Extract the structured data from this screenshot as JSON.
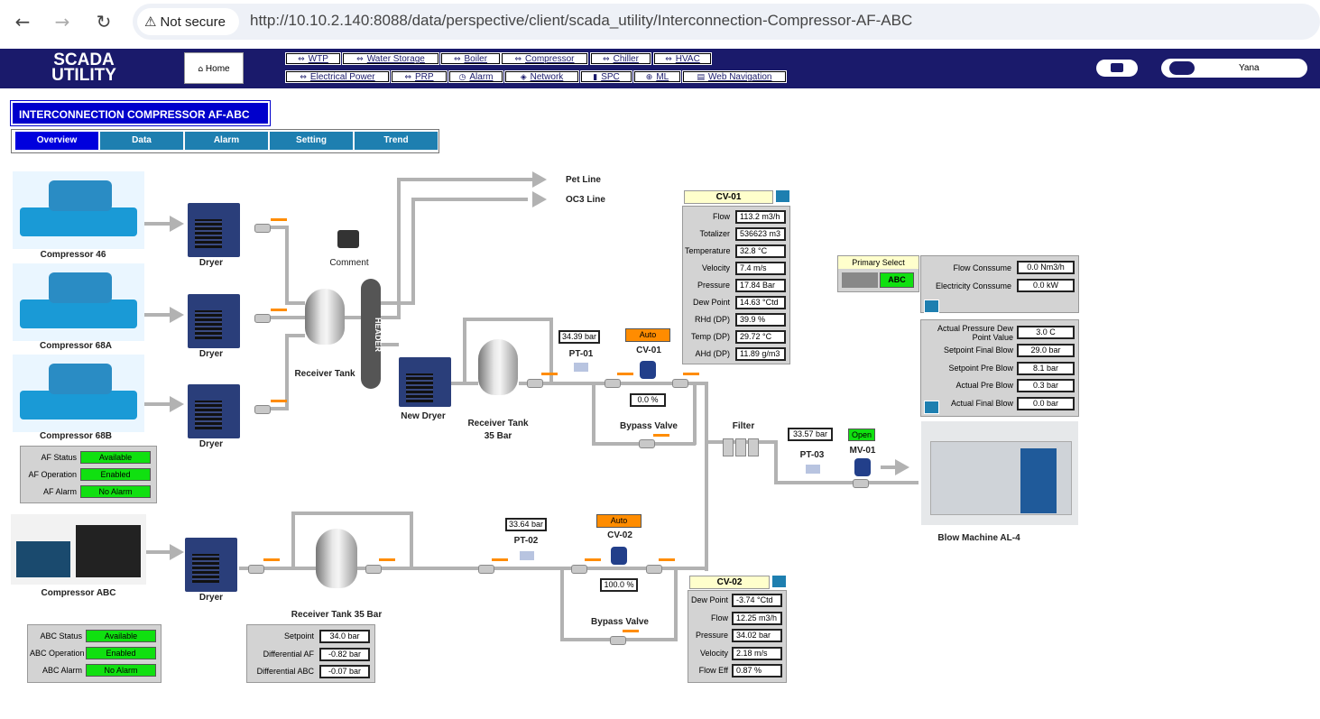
{
  "browser": {
    "security_label": "Not secure",
    "url": "http://10.10.2.140:8088/data/perspective/client/scada_utility/Interconnection-Compressor-AF-ABC"
  },
  "header": {
    "logo_line1": "SCADA",
    "logo_line2": "UTILITY",
    "home_label": "Home",
    "menu_row1": [
      "WTP",
      "Water Storage",
      "Boiler",
      "Compressor",
      "Chiller",
      "HVAC"
    ],
    "menu_row2": [
      "Electrical Power",
      "PRP",
      "Alarm",
      "Network",
      "SPC",
      "ML",
      "Web Navigation"
    ],
    "user_name": "Yana"
  },
  "page": {
    "title": "INTERCONNECTION COMPRESSOR AF-ABC",
    "tabs": [
      "Overview",
      "Data",
      "Alarm",
      "Setting",
      "Trend"
    ],
    "active_tab": "Overview"
  },
  "diagram": {
    "compressors": [
      "Compressor 46",
      "Compressor 68A",
      "Compressor 68B",
      "Compressor ABC"
    ],
    "dryer_label": "Dryer",
    "new_dryer_label": "New Dryer",
    "comment_label": "Comment",
    "receiver_tank_label": "Receiver Tank",
    "header_label": "HEADER",
    "receiver_tank_35_label": "Receiver Tank\n35 Bar",
    "receiver_tank_35b_label": "Receiver Tank 35 Bar",
    "pet_line": "Pet Line",
    "oc3_line": "OC3 Line",
    "pt01": {
      "label": "PT-01",
      "value": "34.39 bar"
    },
    "pt02": {
      "label": "PT-02",
      "value": "33.64 bar"
    },
    "pt03": {
      "label": "PT-03",
      "value": "33.57 bar"
    },
    "cv01": {
      "label": "CV-01",
      "mode": "Auto",
      "opening": "0.0 %"
    },
    "cv02": {
      "label": "CV-02",
      "mode": "Auto",
      "opening": "100.0 %"
    },
    "bypass_valve": "Bypass Valve",
    "filter": "Filter",
    "mv01": {
      "label": "MV-01",
      "state": "Open"
    },
    "blow_machine": "Blow Machine AL-4"
  },
  "af_status": [
    {
      "label": "AF Status",
      "value": "Available"
    },
    {
      "label": "AF Operation",
      "value": "Enabled"
    },
    {
      "label": "AF Alarm",
      "value": "No Alarm"
    }
  ],
  "abc_status": [
    {
      "label": "ABC Status",
      "value": "Available"
    },
    {
      "label": "ABC Operation",
      "value": "Enabled"
    },
    {
      "label": "ABC Alarm",
      "value": "No Alarm"
    }
  ],
  "setpoint_panel": [
    {
      "label": "Setpoint",
      "value": "34.0 bar"
    },
    {
      "label": "Differential AF",
      "value": "-0.82 bar"
    },
    {
      "label": "Differential ABC",
      "value": "-0.07 bar"
    }
  ],
  "cv01_panel": {
    "title": "CV-01",
    "rows": [
      {
        "label": "Flow",
        "value": "113.2 m3/h"
      },
      {
        "label": "Totalizer",
        "value": "536623 m3"
      },
      {
        "label": "Temperature",
        "value": "32.8     °C"
      },
      {
        "label": "Velocity",
        "value": "7.4       m/s"
      },
      {
        "label": "Pressure",
        "value": "17.84  Bar"
      },
      {
        "label": "Dew Point",
        "value": "14.63 °Ctd"
      },
      {
        "label": "RHd (DP)",
        "value": "39.9       %"
      },
      {
        "label": "Temp (DP)",
        "value": "29.72    °C"
      },
      {
        "label": "AHd (DP)",
        "value": "11.89 g/m3"
      }
    ]
  },
  "cv02_panel": {
    "title": "CV-02",
    "rows": [
      {
        "label": "Dew Point",
        "value": "-3.74  °Ctd"
      },
      {
        "label": "Flow",
        "value": "12.25 m3/h"
      },
      {
        "label": "Pressure",
        "value": "34.02  bar"
      },
      {
        "label": "Velocity",
        "value": "2.18    m/s"
      },
      {
        "label": "Flow Eff",
        "value": "0.87       %"
      }
    ]
  },
  "primary_select": {
    "title": "Primary Select",
    "value": "ABC"
  },
  "consume_panel": [
    {
      "label": "Flow Conssume",
      "value": "0.0 Nm3/h"
    },
    {
      "label": "Electricity Conssume",
      "value": "0.0 kW"
    }
  ],
  "blow_panel": [
    {
      "label": "Actual Pressure Dew Point Value",
      "value": "3.0 C"
    },
    {
      "label": "Setpoint Final Blow",
      "value": "29.0 bar"
    },
    {
      "label": "Setpoint Pre Blow",
      "value": "8.1 bar"
    },
    {
      "label": "Actual Pre Blow",
      "value": "0.3 bar"
    },
    {
      "label": "Actual Final Blow",
      "value": "0.0 bar"
    }
  ],
  "colors": {
    "navy": "#1a1a6b",
    "tab_blue": "#1e7fb0",
    "active_tab": "#0000dd",
    "green": "#10e010",
    "orange": "#ff8c00"
  }
}
